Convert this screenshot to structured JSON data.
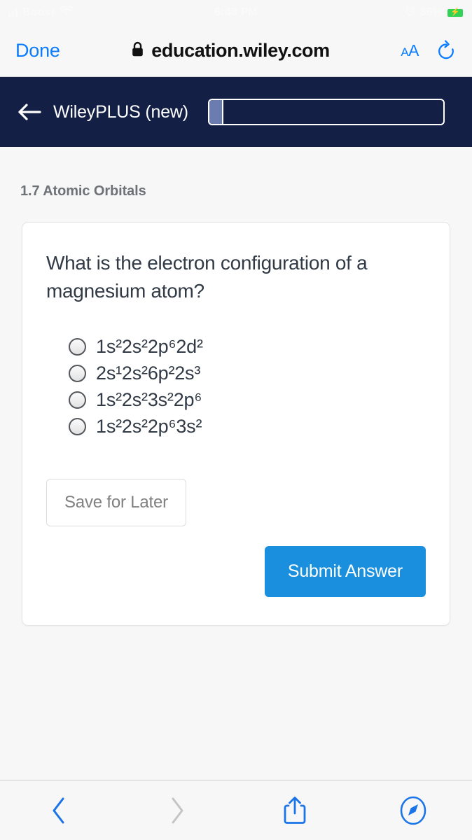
{
  "status_bar": {
    "carrier": "Boost",
    "time": "6:48 PM",
    "battery_pct": "36%",
    "signal_icon": "signal-bars-icon",
    "wifi_icon": "wifi-icon",
    "alarm_icon": "alarm-clock-icon",
    "battery_icon": "battery-charging-icon",
    "battery_color": "#32d257"
  },
  "safari_top": {
    "done_label": "Done",
    "lock_icon": "lock-icon",
    "url": "education.wiley.com",
    "text_size_label": "AA",
    "text_size_small": "A",
    "reload_icon": "reload-icon",
    "accent_color": "#0a7cff"
  },
  "app_header": {
    "back_icon": "back-arrow-icon",
    "title": "WileyPLUS (new)",
    "bg_color": "#131f45",
    "progress_fill_color": "#6b7cb0"
  },
  "page": {
    "section_title": "1.7 Atomic Orbitals",
    "question": "What is the electron configuration of a magnesium atom?",
    "options": [
      {
        "label": "1s²2s²2p⁶2d²",
        "selected": false
      },
      {
        "label": "2s¹2s²6p²2s³",
        "selected": false
      },
      {
        "label": "1s²2s²3s²2p⁶",
        "selected": false
      },
      {
        "label": "1s²2s²2p⁶3s²",
        "selected": false
      }
    ],
    "save_label": "Save for Later",
    "submit_label": "Submit Answer",
    "submit_color": "#1a8fdd"
  },
  "bottom_bar": {
    "back_icon": "chevron-left-icon",
    "forward_icon": "chevron-right-icon",
    "share_icon": "share-icon",
    "tabs_icon": "safari-compass-icon",
    "enabled_color": "#1a74e8",
    "disabled_color": "#c4c4c4"
  }
}
